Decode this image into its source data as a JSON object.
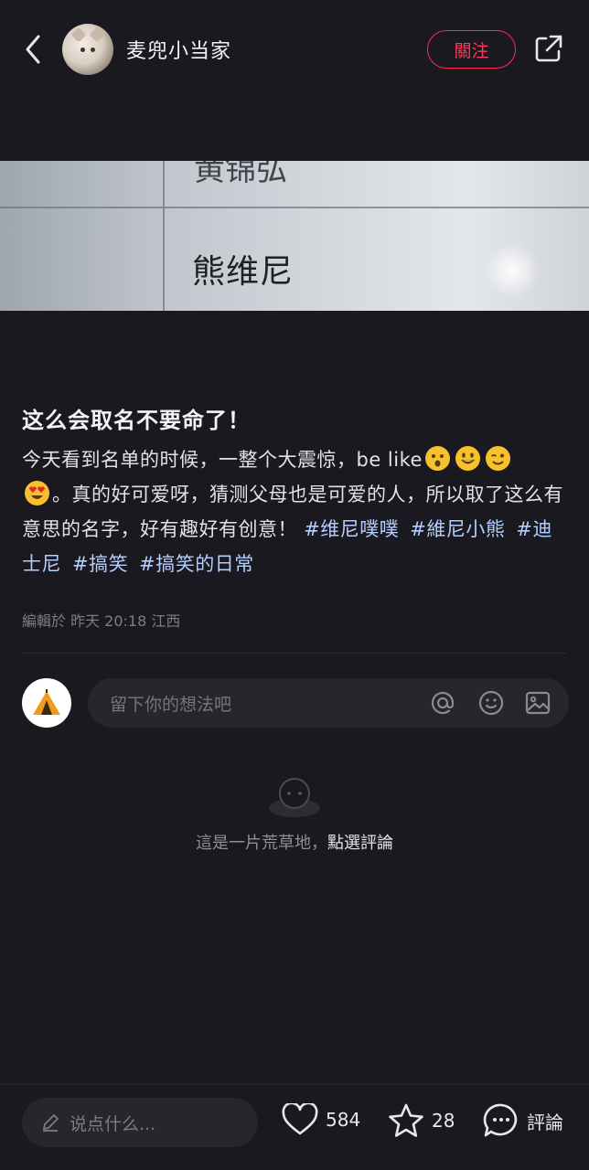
{
  "header": {
    "author_name": "麦兜小当家",
    "follow_label": "關注",
    "icons": [
      "back-icon",
      "share-icon"
    ]
  },
  "photo": {
    "top_text": "黄锦弘",
    "name_text": "熊维尼"
  },
  "post": {
    "title": "这么会取名不要命了！",
    "body_part1": "今天看到名单的时候，一整个大震惊，be like",
    "body_part2": "。真的好可爱呀，猜测父母也是可爱的人，所以取了这么有意思的名字，好有趣好有创意！",
    "tags": [
      "#维尼噗噗",
      "#維尼小熊",
      "#迪士尼",
      "#搞笑",
      "#搞笑的日常"
    ],
    "meta": "編輯於 昨天 20:18 江西"
  },
  "comment_box": {
    "placeholder": "留下你的想法吧",
    "icons": [
      "at-icon",
      "emoji-icon",
      "image-icon"
    ]
  },
  "empty_state": {
    "text": "這是一片荒草地，",
    "link": "點選評論"
  },
  "bottom_bar": {
    "input_placeholder": "说点什么...",
    "likes": "584",
    "favorites": "28",
    "comment_label": "評論"
  },
  "colors": {
    "background": "#19191f",
    "accent": "#ff2a4f",
    "tag": "#b3cfff"
  }
}
